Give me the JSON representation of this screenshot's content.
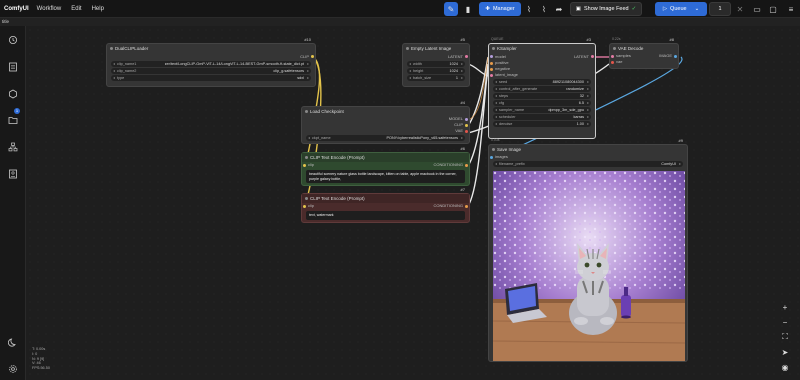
{
  "app": {
    "name": "ComfyUI"
  },
  "menu": [
    "Workflow",
    "Edit",
    "Help"
  ],
  "tab": {
    "label": "title"
  },
  "toolbar": {
    "manager_label": "Manager",
    "image_feed_label": "Show Image Feed",
    "queue_label": "Queue",
    "queue_count": "1"
  },
  "sidebar": {
    "badge_count": "1"
  },
  "nodes": {
    "dualclip": {
      "id": "#10",
      "title": "DualCLIPLoader",
      "output_clip": "CLIP",
      "clip_name1_label": "clip_name1",
      "clip_name1_value": "zer/text/LongCLIP-GmP-ViT-L-14/LongViT-L-14-BEST-GmP-smooth-ft-state_dict.pt",
      "clip_name2_label": "clip_name2",
      "clip_name2_value": "clip_g.safetensors",
      "type_label": "type",
      "type_value": "sdxl"
    },
    "empty_latent": {
      "id": "#5",
      "title": "Empty Latent Image",
      "output": "LATENT",
      "width_label": "width",
      "width_value": "1024",
      "height_label": "height",
      "height_value": "1024",
      "batch_label": "batch_size",
      "batch_value": "1"
    },
    "ksampler": {
      "id": "#3",
      "group": "QUEUE",
      "title": "KSampler",
      "output": "LATENT",
      "inputs": [
        "model",
        "positive",
        "negative",
        "latent_image"
      ],
      "widgets": [
        {
          "label": "seed",
          "value": "889211080044300"
        },
        {
          "label": "control_after_generate",
          "value": "randomize"
        },
        {
          "label": "steps",
          "value": "32"
        },
        {
          "label": "cfg",
          "value": "6.5"
        },
        {
          "label": "sampler_name",
          "value": "dpmpp_3m_sde_gpu"
        },
        {
          "label": "scheduler",
          "value": "karras"
        },
        {
          "label": "denoise",
          "value": "1.00"
        }
      ]
    },
    "vaedecode": {
      "id": "#8",
      "group": "0.22s",
      "title": "VAE Decode",
      "in1": "samples",
      "in2": "vae",
      "output": "IMAGE"
    },
    "checkpoint": {
      "id": "#4",
      "title": "Load Checkpoint",
      "out_model": "MODEL",
      "out_clip": "CLIP",
      "out_vae": "VAE",
      "ckpt_label": "ckpt_name",
      "ckpt_value": "PONY/cyberrealisticPony_v65.safetensors"
    },
    "clip_pos": {
      "id": "#6",
      "title": "CLIP Text Encode (Prompt)",
      "input": "clip",
      "output": "CONDITIONING",
      "text": "beautiful scenery nature glass bottle landscape, kitten on table, apple macbook in the corner, purple galaxy bottle,"
    },
    "clip_neg": {
      "id": "#7",
      "title": "CLIP Text Encode (Prompt)",
      "input": "clip",
      "output": "CONDITIONING",
      "text": "text, watermark"
    },
    "save": {
      "id": "#9",
      "group": "0.03s",
      "title": "Save Image",
      "input": "images",
      "prefix_label": "filename_prefix",
      "prefix_value": "ComfyUI"
    }
  },
  "stats": {
    "line1": "T: 0.00s",
    "line2": "I: 0",
    "line3": "N: 9 [9]",
    "line4": "V: 46",
    "line5": "FPS:56.50"
  },
  "colors": {
    "accent": "#2e6bd6",
    "link_yellow": "#e3c34b",
    "link_white": "#e8e8e8",
    "link_blue": "#5aa7e0",
    "link_orange": "#e89c4a",
    "link_pink": "#e27aa3",
    "node_green": "#2f4a2f",
    "node_red": "#4a2b2b"
  }
}
